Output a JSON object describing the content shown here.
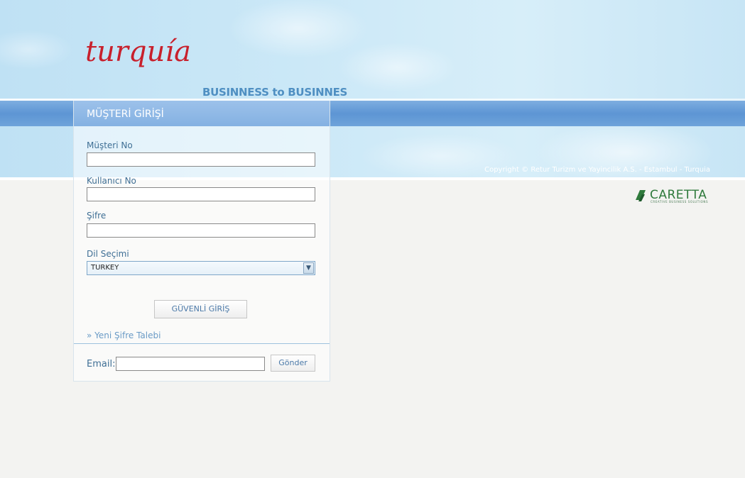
{
  "brand": {
    "logo_text": "turquía",
    "tagline": "BUSINNESS to BUSINNES",
    "copyright": "Copyright © Retur Turizm ve Yayincilik A.S. - Estambul - Turquia",
    "partner_logo": "CARETTA",
    "partner_tagline": "CREATIVE BUSINESS SOLUTIONS"
  },
  "colors": {
    "accent": "#4f8fc2",
    "band": "#5d95d4",
    "label": "#3f6f95",
    "logo_red": "#c8202c",
    "partner_green": "#2f7a3c"
  },
  "login": {
    "title": "MÜŞTERİ GİRİŞİ",
    "customer_no_label": "Müşteri No",
    "customer_no_value": "",
    "username_label": "Kullanıcı No",
    "username_value": "",
    "password_label": "Şifre",
    "password_value": "",
    "language_label": "Dil Seçimi",
    "language_selected": "TURKEY",
    "submit_label": "GÜVENLİ GİRİŞ",
    "forgot_link": "» Yeni Şifre Talebi"
  },
  "reset": {
    "email_label": "Email:",
    "email_value": "",
    "send_label": "Gönder"
  },
  "icons": [
    "dropdown-arrow-icon",
    "turquia-logo",
    "caretta-logo"
  ]
}
